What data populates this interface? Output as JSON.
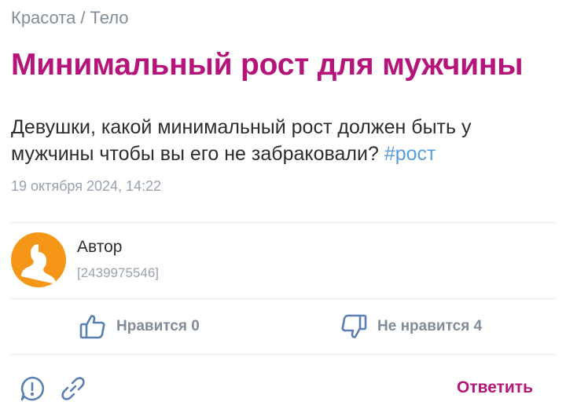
{
  "breadcrumb": {
    "category": "Красота",
    "separator": "/",
    "subcategory": "Тело"
  },
  "question": {
    "title": "Минимальный рост для мужчины",
    "body": "Девушки, какой минимальный рост должен быть у мужчины чтобы вы его не забраковали?",
    "tag": "#рост",
    "date": "19 октября 2024, 14:22"
  },
  "author": {
    "name": "Автор",
    "id": "[2439975546]",
    "avatar_icon": "user-silhouette-icon",
    "avatar_color": "#f59618"
  },
  "votes": {
    "like_label": "Нравится 0",
    "dislike_label": "Не нравится 4"
  },
  "actions": {
    "report_icon": "exclamation-bubble-icon",
    "link_icon": "chain-link-icon",
    "reply_label": "Ответить"
  },
  "colors": {
    "accent": "#b5157a",
    "hashtag": "#5a9ddb",
    "muted": "#818c99"
  }
}
